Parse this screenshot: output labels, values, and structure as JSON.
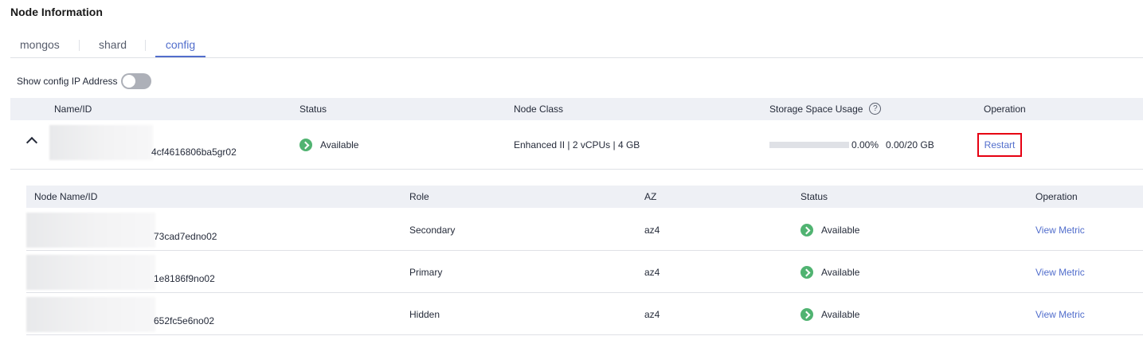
{
  "section": {
    "title": "Node Information"
  },
  "tabs": [
    {
      "label": "mongos",
      "active": false
    },
    {
      "label": "shard",
      "active": false
    },
    {
      "label": "config",
      "active": true
    }
  ],
  "toggle": {
    "label": "Show config IP Address",
    "on": false
  },
  "group_table": {
    "headers": {
      "name": "Name/ID",
      "status": "Status",
      "node_class": "Node Class",
      "storage": "Storage Space Usage",
      "operation": "Operation"
    },
    "row": {
      "id_suffix": "4cf4616806ba5gr02",
      "status": "Available",
      "node_class": "Enhanced II | 2 vCPUs | 4 GB",
      "storage_percent_label": "0.00%",
      "storage_percent": 0.0,
      "storage_usage": "0.00/20 GB",
      "action": "Restart"
    }
  },
  "node_table": {
    "headers": {
      "name": "Node Name/ID",
      "role": "Role",
      "az": "AZ",
      "status": "Status",
      "operation": "Operation"
    },
    "rows": [
      {
        "id_suffix": "73cad7edno02",
        "role": "Secondary",
        "az": "az4",
        "status": "Available",
        "action": "View Metric"
      },
      {
        "id_suffix": "1e8186f9no02",
        "role": "Primary",
        "az": "az4",
        "status": "Available",
        "action": "View Metric"
      },
      {
        "id_suffix": "652fc5e6no02",
        "role": "Hidden",
        "az": "az4",
        "status": "Available",
        "action": "View Metric"
      }
    ]
  },
  "colors": {
    "accent": "#526ecc",
    "status_ok": "#50b371",
    "highlight_border": "#e60012"
  }
}
